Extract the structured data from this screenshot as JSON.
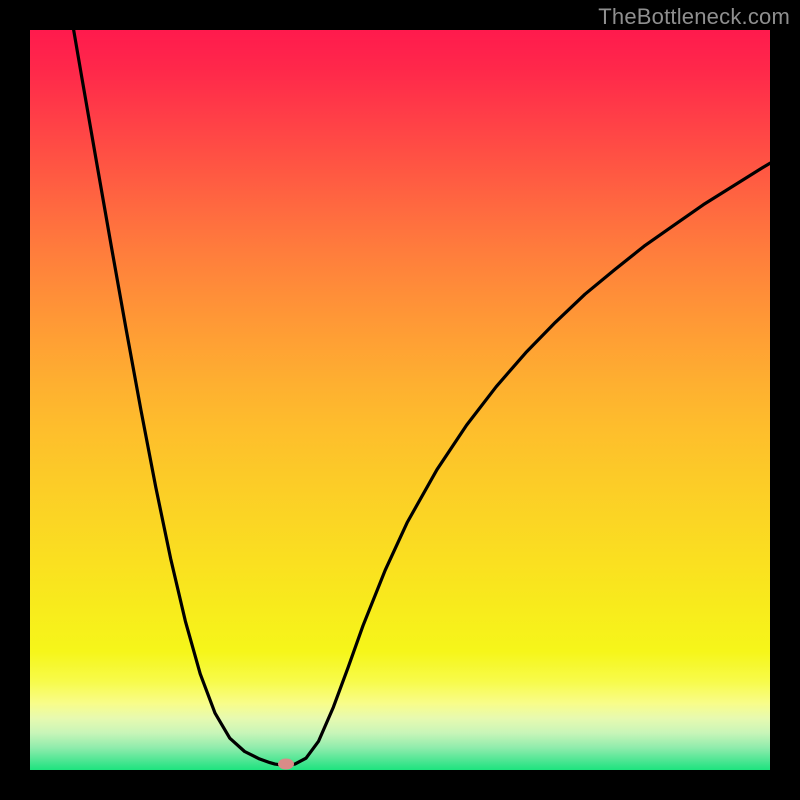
{
  "watermark": "TheBottleneck.com",
  "colors": {
    "frame": "#000000",
    "curve": "#000000",
    "marker": "#d98b88",
    "gradient_top": "#ff1a4d",
    "gradient_bottom": "#1ee47e"
  },
  "chart_data": {
    "type": "line",
    "title": "",
    "xlabel": "",
    "ylabel": "",
    "xlim": [
      0,
      100
    ],
    "ylim": [
      0,
      100
    ],
    "grid": false,
    "note": "No axis ticks or labels are visible; values are estimated from pixel positions on a 0–100 normalized scale (origin bottom-left of the colored plot area).",
    "series": [
      {
        "name": "curve",
        "x": [
          5.9,
          7.0,
          9.0,
          11.0,
          13.0,
          15.0,
          17.0,
          19.0,
          21.0,
          23.0,
          25.0,
          27.0,
          29.0,
          31.0,
          32.4,
          33.1,
          33.8,
          34.2,
          34.6,
          35.1,
          35.8,
          37.3,
          39.0,
          41.0,
          43.0,
          45.0,
          48.0,
          51.0,
          55.0,
          59.0,
          63.0,
          67.0,
          71.0,
          75.0,
          79.0,
          83.0,
          87.0,
          91.0,
          95.0,
          99.0,
          100.0
        ],
        "y": [
          100.0,
          93.6,
          82.1,
          70.7,
          59.5,
          48.6,
          38.2,
          28.6,
          20.1,
          13.0,
          7.7,
          4.3,
          2.5,
          1.5,
          1.0,
          0.8,
          0.7,
          0.7,
          0.7,
          0.7,
          0.8,
          1.6,
          3.9,
          8.5,
          13.9,
          19.5,
          27.0,
          33.5,
          40.6,
          46.6,
          51.8,
          56.4,
          60.5,
          64.3,
          67.6,
          70.8,
          73.6,
          76.4,
          78.9,
          81.4,
          82.0
        ]
      }
    ],
    "marker": {
      "x": 34.6,
      "y": 0.8
    }
  }
}
